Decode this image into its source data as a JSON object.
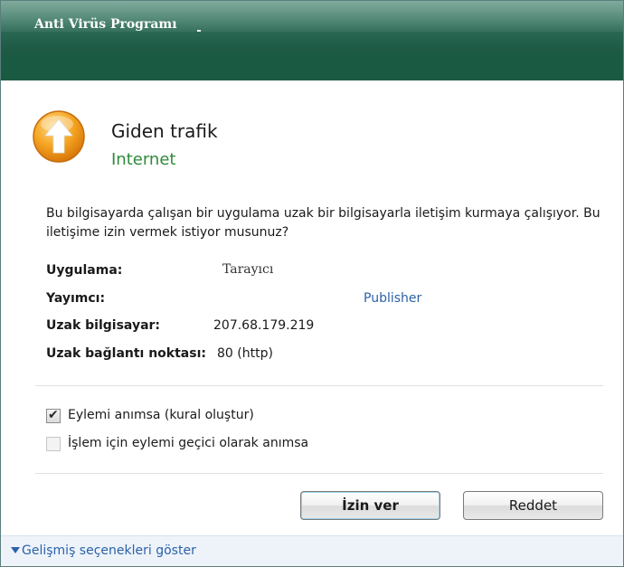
{
  "window": {
    "title": "Anti Virüs Programı"
  },
  "header": {
    "title": "Giden trafik",
    "subtitle": "Internet",
    "icon": "up-arrow-icon"
  },
  "description": "Bu bilgisayarda çalışan bir uygulama uzak bir bilgisayarla iletişim kurmaya çalışıyor. Bu iletişime izin vermek istiyor musunuz?",
  "details": {
    "application": {
      "label": "Uygulama:",
      "value": "Tarayıcı"
    },
    "publisher": {
      "label": "Yayımcı:",
      "value": "Publisher"
    },
    "remote_computer": {
      "label": "Uzak bilgisayar:",
      "value": "207.68.179.219"
    },
    "remote_port": {
      "label": "Uzak bağlantı noktası:",
      "value": "80 (http)"
    }
  },
  "options": {
    "remember_action": {
      "label": "Eylemi anımsa (kural oluştur)",
      "checked": true
    },
    "remember_temp": {
      "label": "İşlem için eylemi geçici olarak anımsa",
      "checked": false
    }
  },
  "buttons": {
    "allow": "İzin ver",
    "deny": "Reddet"
  },
  "footer": {
    "advanced_label": "Gelişmiş seçenekleri göster"
  },
  "colors": {
    "titlebar": "#1e5a45",
    "subtitle": "#2e8b3a",
    "link": "#2a62a8",
    "icon": "#f39a1a"
  }
}
